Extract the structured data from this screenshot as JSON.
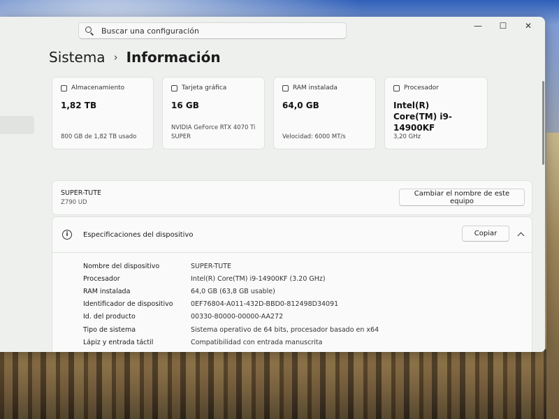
{
  "search": {
    "placeholder": "Buscar una configuración"
  },
  "window_controls": {
    "minimize": "—",
    "maximize": "☐",
    "close": "✕"
  },
  "breadcrumb": {
    "parent": "Sistema",
    "separator": "›",
    "current": "Información"
  },
  "cards": [
    {
      "label": "Almacenamiento",
      "value": "1,82 TB",
      "sub": "800 GB de 1,82 TB usado",
      "icon": "storage-icon"
    },
    {
      "label": "Tarjeta gráfica",
      "value": "16 GB",
      "sub": "NVIDIA GeForce RTX 4070 Ti SUPER",
      "icon": "gpu-icon"
    },
    {
      "label": "RAM instalada",
      "value": "64,0 GB",
      "sub": "Velocidad: 6000 MT/s",
      "icon": "ram-icon"
    },
    {
      "label": "Procesador",
      "value": "Intel(R) Core(TM) i9-14900KF",
      "sub": "3,20 GHz",
      "icon": "processor-icon"
    }
  ],
  "device": {
    "name": "SUPER-TUTE",
    "model": "Z790 UD",
    "rename_button": "Cambiar el nombre de este equipo"
  },
  "specs": {
    "title": "Especificaciones del dispositivo",
    "copy_button": "Copiar",
    "rows": [
      {
        "label": "Nombre del dispositivo",
        "value": "SUPER-TUTE"
      },
      {
        "label": "Procesador",
        "value": "Intel(R) Core(TM) i9-14900KF (3.20 GHz)"
      },
      {
        "label": "RAM instalada",
        "value": "64,0 GB (63,8 GB usable)"
      },
      {
        "label": "Identificador de dispositivo",
        "value": "0EF76804-A011-432D-BBD0-812498D34091"
      },
      {
        "label": "Id. del producto",
        "value": "00330-80000-00000-AA272"
      },
      {
        "label": "Tipo de sistema",
        "value": "Sistema operativo de 64 bits, procesador basado en x64"
      },
      {
        "label": "Lápiz y entrada táctil",
        "value": "Compatibilidad con entrada manuscrita"
      }
    ]
  }
}
